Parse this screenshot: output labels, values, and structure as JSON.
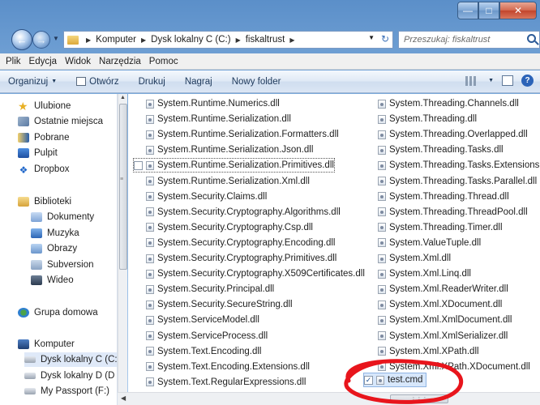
{
  "colors": {
    "annotation": "#e8151c",
    "accent": "#2b63b8"
  },
  "address": {
    "crumbs": [
      "Komputer",
      "Dysk lokalny C (C:)",
      "fiskaltrust"
    ],
    "search_placeholder": "Przeszukaj: fiskaltrust"
  },
  "menu": [
    "Plik",
    "Edycja",
    "Widok",
    "Narzędzia",
    "Pomoc"
  ],
  "toolbar": {
    "organize": "Organizuj",
    "open": "Otwórz",
    "print": "Drukuj",
    "burn": "Nagraj",
    "new_folder": "Nowy folder"
  },
  "nav": {
    "favorites": "Ulubione",
    "recent": "Ostatnie miejsca",
    "downloads": "Pobrane",
    "desktop": "Pulpit",
    "dropbox": "Dropbox",
    "libraries": "Biblioteki",
    "documents": "Dokumenty",
    "music": "Muzyka",
    "pictures": "Obrazy",
    "subversion": "Subversion",
    "video": "Wideo",
    "homegroup": "Grupa domowa",
    "computer": "Komputer",
    "drive_c": "Dysk lokalny C (C:",
    "drive_d": "Dysk lokalny D (D",
    "passport": "My Passport (F:)"
  },
  "files_col1": [
    "System.Runtime.Numerics.dll",
    "System.Runtime.Serialization.dll",
    "System.Runtime.Serialization.Formatters.dll",
    "System.Runtime.Serialization.Json.dll",
    "System.Runtime.Serialization.Primitives.dll",
    "System.Runtime.Serialization.Xml.dll",
    "System.Security.Claims.dll",
    "System.Security.Cryptography.Algorithms.dll",
    "System.Security.Cryptography.Csp.dll",
    "System.Security.Cryptography.Encoding.dll",
    "System.Security.Cryptography.Primitives.dll",
    "System.Security.Cryptography.X509Certificates.dll",
    "System.Security.Principal.dll",
    "System.Security.SecureString.dll",
    "System.ServiceModel.dll",
    "System.ServiceProcess.dll",
    "System.Text.Encoding.dll",
    "System.Text.Encoding.Extensions.dll",
    "System.Text.RegularExpressions.dll"
  ],
  "files_col2": [
    "System.Threading.Channels.dll",
    "System.Threading.dll",
    "System.Threading.Overlapped.dll",
    "System.Threading.Tasks.dll",
    "System.Threading.Tasks.Extensions.dll",
    "System.Threading.Tasks.Parallel.dll",
    "System.Threading.Thread.dll",
    "System.Threading.ThreadPool.dll",
    "System.Threading.Timer.dll",
    "System.ValueTuple.dll",
    "System.Xml.dll",
    "System.Xml.Linq.dll",
    "System.Xml.ReaderWriter.dll",
    "System.Xml.XDocument.dll",
    "System.Xml.XmlDocument.dll",
    "System.Xml.XmlSerializer.dll",
    "System.Xml.XPath.dll",
    "System.Xml.XPath.XDocument.dll"
  ],
  "selected_file": "test.cmd",
  "selected_check": "✓"
}
